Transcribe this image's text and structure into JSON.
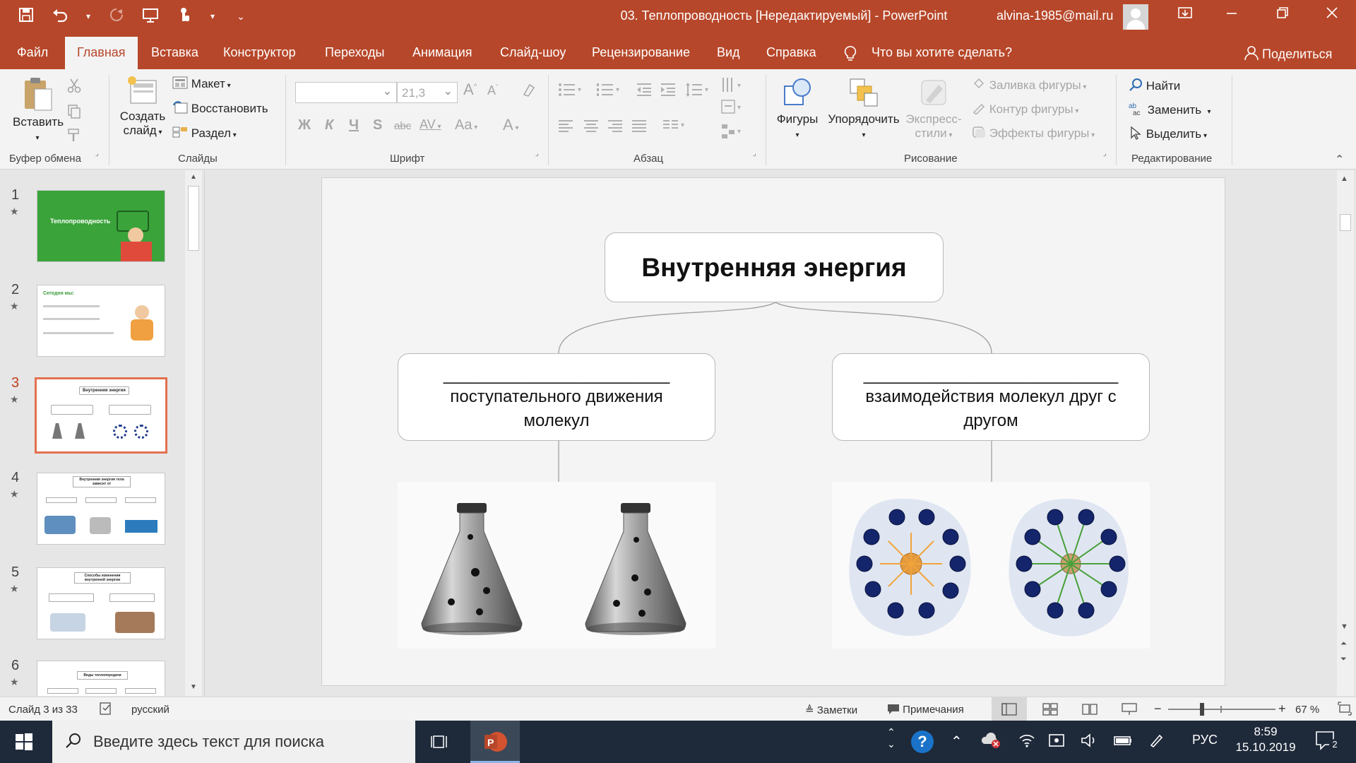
{
  "titlebar": {
    "title": "03. Теплопроводность [Нередактируемый]  -  PowerPoint",
    "account": "alvina-1985@mail.ru"
  },
  "tabs": {
    "items": [
      "Файл",
      "Главная",
      "Вставка",
      "Конструктор",
      "Переходы",
      "Анимация",
      "Слайд-шоу",
      "Рецензирование",
      "Вид",
      "Справка"
    ],
    "active": "Главная",
    "tell_me": "Что вы хотите сделать?",
    "share": "Поделиться"
  },
  "ribbon": {
    "clipboard": {
      "paste": "Вставить",
      "label": "Буфер обмена"
    },
    "slides": {
      "new_slide_1": "Создать",
      "new_slide_2": "слайд",
      "layout": "Макет",
      "reset": "Восстановить",
      "section": "Раздел",
      "label": "Слайды"
    },
    "font": {
      "size": "21,3",
      "bold": "Ж",
      "italic": "К",
      "underline": "Ч",
      "shadow": "S",
      "strike": "abc",
      "spacing": "AV",
      "case": "Aa",
      "color": "A",
      "grow": "A",
      "shrink": "A",
      "label": "Шрифт"
    },
    "paragraph": {
      "label": "Абзац"
    },
    "drawing": {
      "shapes": "Фигуры",
      "arrange": "Упорядочить",
      "quick_styles_1": "Экспресс-",
      "quick_styles_2": "стили",
      "fill": "Заливка фигуры",
      "outline": "Контур фигуры",
      "effects": "Эффекты фигуры",
      "label": "Рисование"
    },
    "editing": {
      "find": "Найти",
      "replace": "Заменить",
      "select": "Выделить",
      "label": "Редактирование"
    }
  },
  "thumbnails": {
    "numbers": [
      "1",
      "2",
      "3",
      "4",
      "5",
      "6"
    ],
    "active_index": 3,
    "s1_title": "Теплопроводность",
    "s2_title": "Сегодня мы:",
    "s3_title": "Внутренняя энергия",
    "s4_title": "Внутренняя энергия тела зависит от",
    "s5_title": "Способы изменения внутренней энергии",
    "s6_title": "Виды теплопередачи"
  },
  "slide": {
    "title": "Внутренняя энергия",
    "left_blank": "________________________",
    "left_text": "поступательного движения молекул",
    "right_blank": "___________________________",
    "right_text": "взаимодействия молекул друг с другом"
  },
  "status": {
    "slide_info": "Слайд 3 из 33",
    "language": "русский",
    "notes": "Заметки",
    "comments": "Примечания",
    "zoom": "67 %"
  },
  "taskbar": {
    "search_placeholder": "Введите здесь текст для поиска",
    "lang": "РУС",
    "time": "8:59",
    "date": "15.10.2019",
    "notifications": "2"
  },
  "colors": {
    "accent": "#b7472a",
    "active_thumb_border": "#e3704f",
    "taskbar": "#1e2a3a"
  }
}
